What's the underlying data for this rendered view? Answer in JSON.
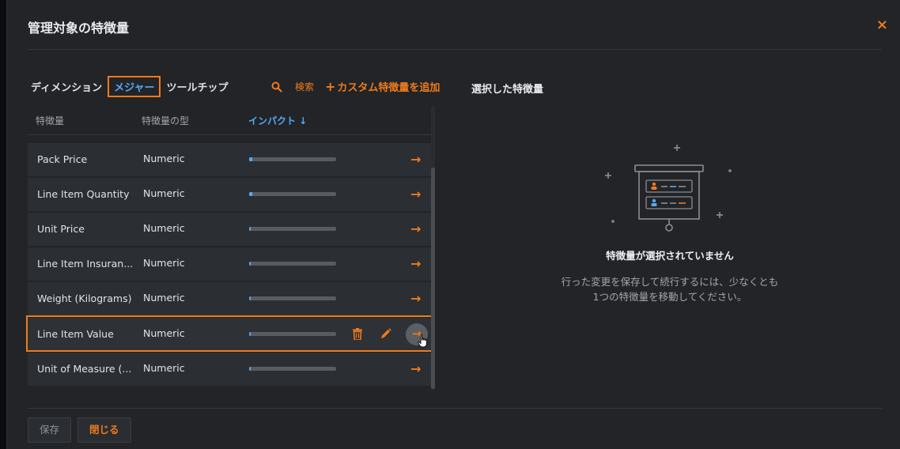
{
  "modal": {
    "title": "管理対象の特徴量",
    "close_label": "×"
  },
  "tabs": [
    "ディメンション",
    "メジャー",
    "ツールチップ"
  ],
  "search_label": "検索",
  "add_custom": {
    "plus": "+",
    "label": "カスタム特徴量を追加"
  },
  "table": {
    "headers": {
      "feature": "特徴量",
      "type": "特徴量の型",
      "impact": "インパクト ↓"
    },
    "rows": [
      {
        "name": "Pack Price",
        "type": "Numeric",
        "impact": 0.04
      },
      {
        "name": "Line Item Quantity",
        "type": "Numeric",
        "impact": 0.035
      },
      {
        "name": "Unit Price",
        "type": "Numeric",
        "impact": 0.02
      },
      {
        "name": "Line Item Insuran...",
        "type": "Numeric",
        "impact": 0.02
      },
      {
        "name": "Weight (Kilograms)",
        "type": "Numeric",
        "impact": 0.02
      },
      {
        "name": "Line Item Value",
        "type": "Numeric",
        "impact": 0.02
      },
      {
        "name": "Unit of Measure (...",
        "type": "Numeric",
        "impact": 0.02
      }
    ],
    "arrow": "→"
  },
  "right_panel": {
    "title": "選択した特徴量",
    "empty_title": "特徴量が選択されていません",
    "empty_desc": "行った変更を保存して続行するには、少なくとも1つの特徴量を移動してください。"
  },
  "footer": {
    "save": "保存",
    "close": "閉じる"
  },
  "colors": {
    "accent": "#f07a1c",
    "link_blue": "#58a9f5",
    "panel": "#222427",
    "row": "#2b2e32"
  }
}
